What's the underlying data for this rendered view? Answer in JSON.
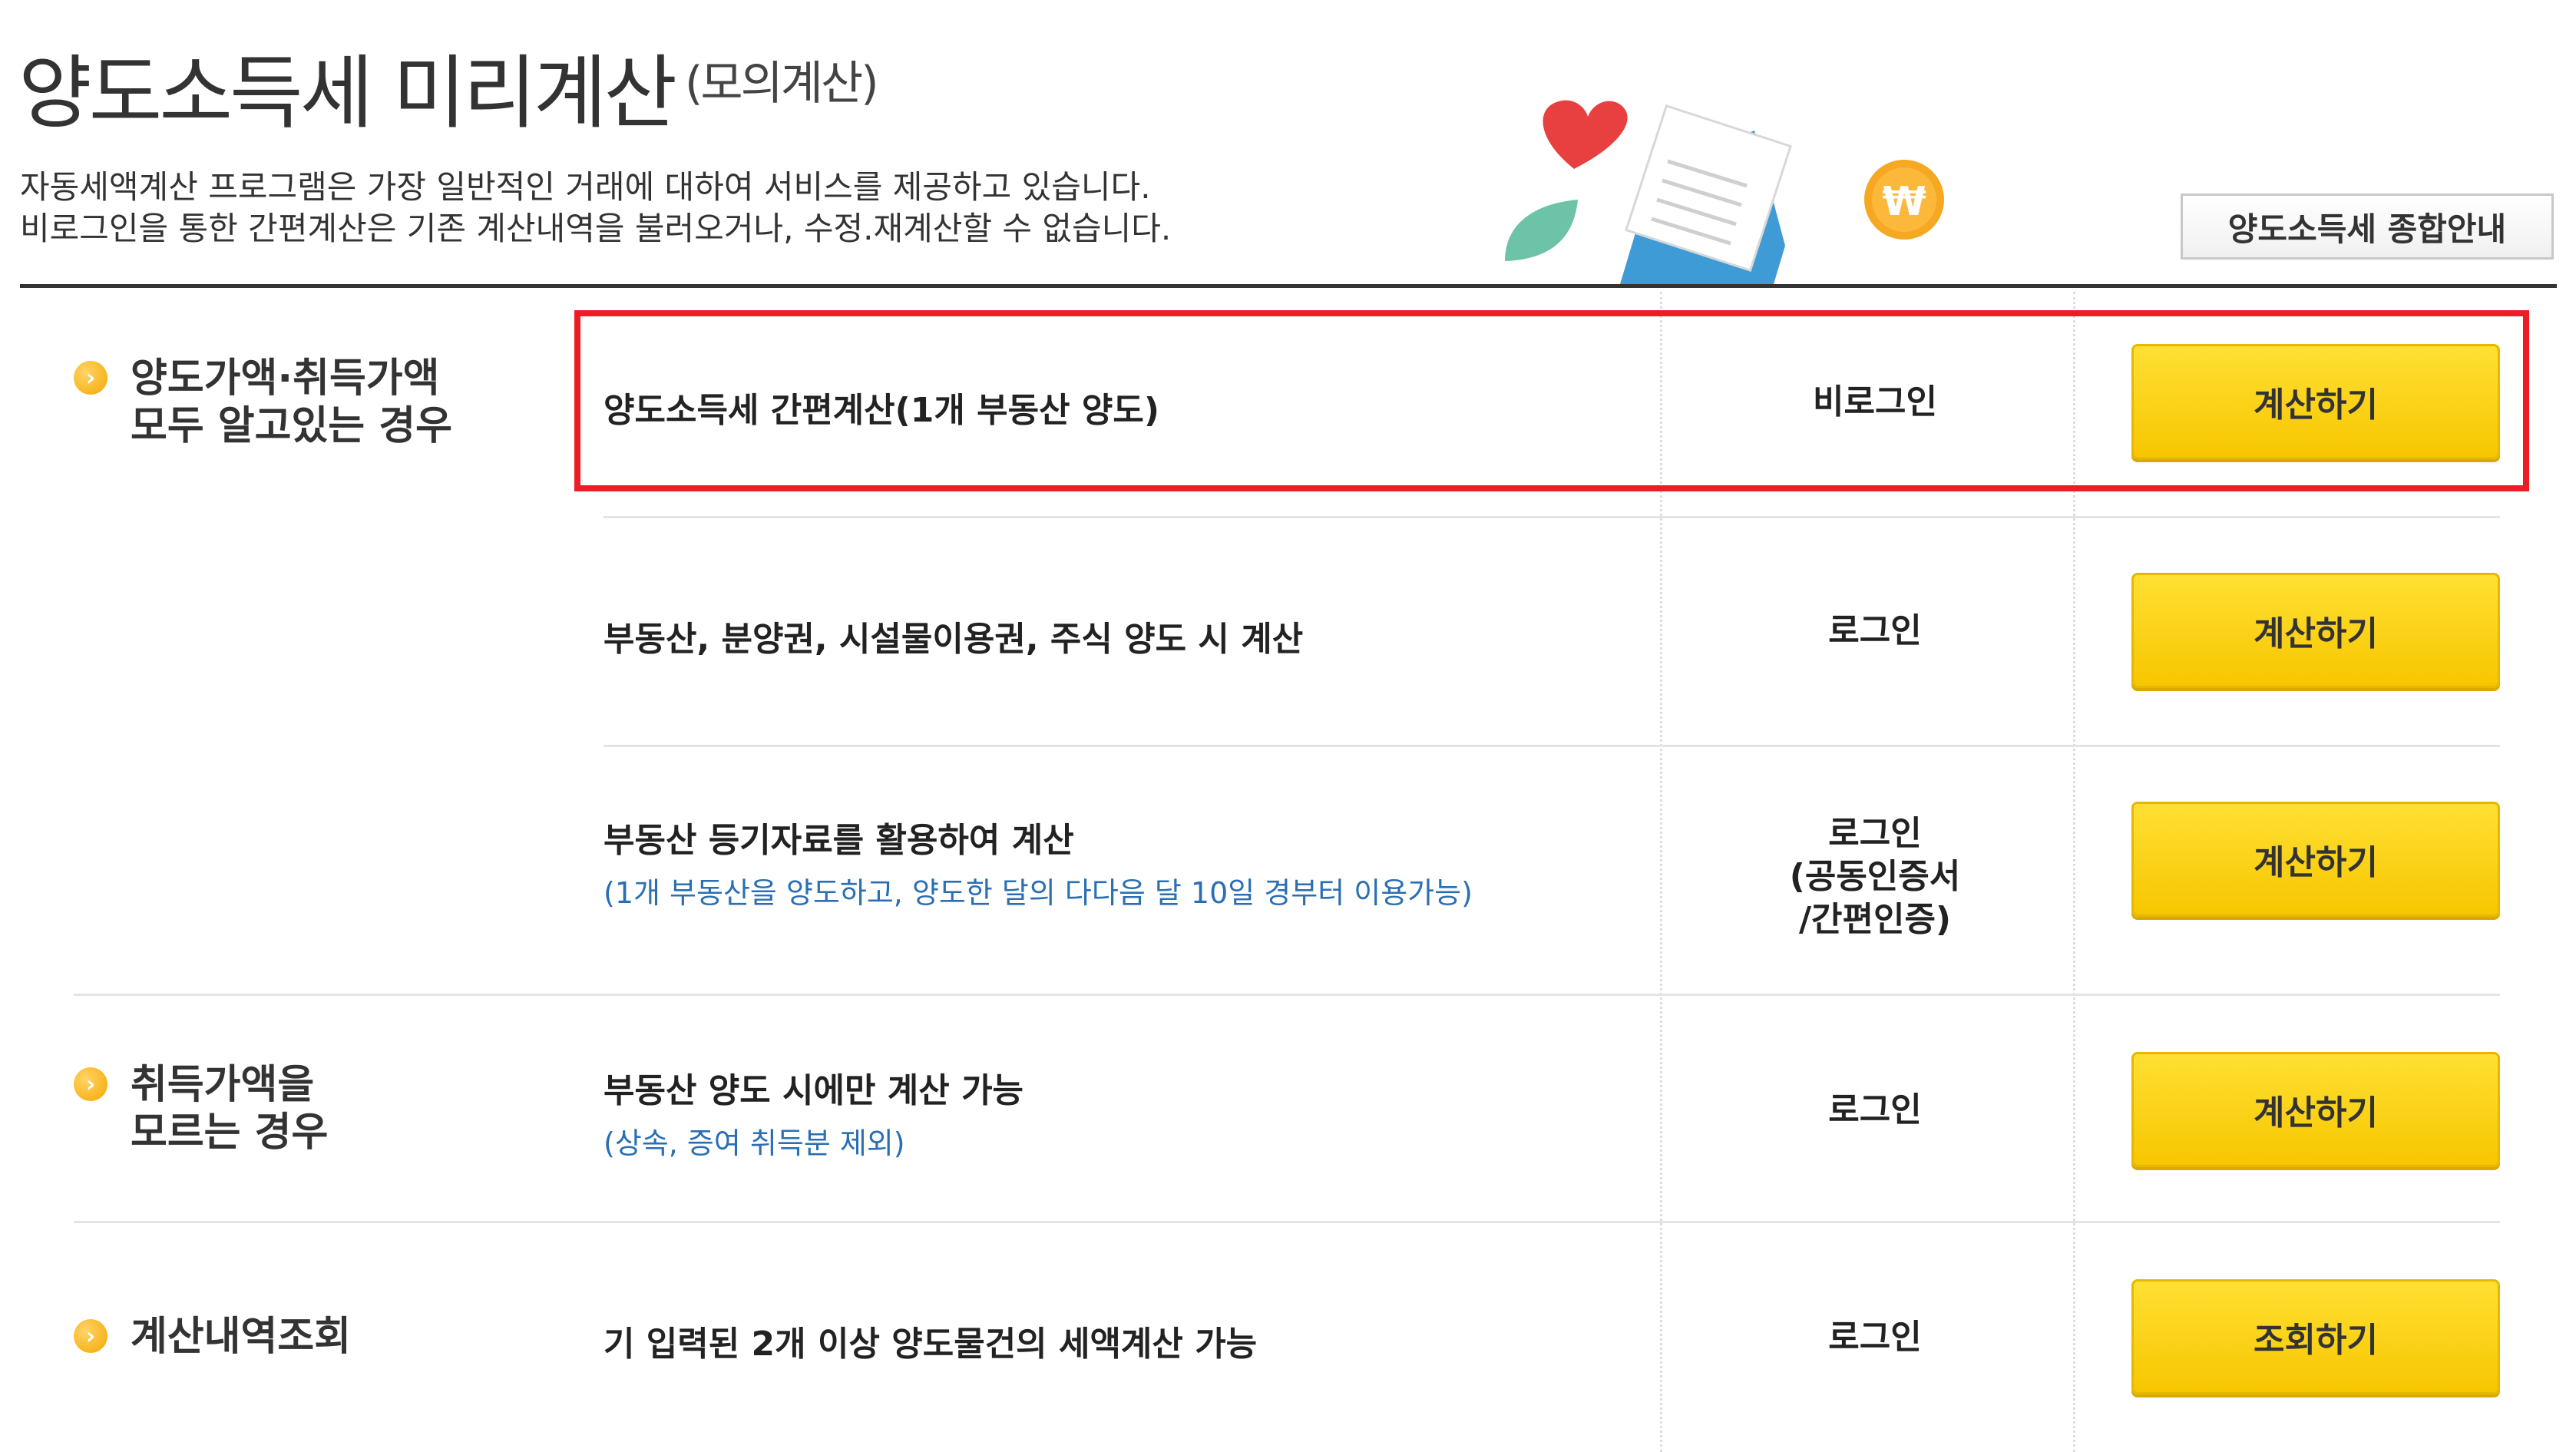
{
  "header": {
    "title": "양도소득세 미리계산",
    "subtitle": "(모의계산)",
    "description_line1": "자동세액계산 프로그램은 가장 일반적인 거래에 대하여 서비스를 제공하고 있습니다.",
    "description_line2": "비로그인을 통한 간편계산은 기존 계산내역을 불러오거나, 수정.재계산할 수 없습니다.",
    "guide_button": "양도소득세 종합안내"
  },
  "categories": [
    {
      "label": "양도가액·취득가액\n모두 알고있는 경우"
    },
    {
      "label": "취득가액을\n모르는 경우"
    },
    {
      "label": "계산내역조회"
    }
  ],
  "rows": [
    {
      "title": "양도소득세 간편계산(1개 부동산 양도)",
      "sub": "",
      "status": "비로그인",
      "button": "계산하기"
    },
    {
      "title": "부동산, 분양권, 시설물이용권, 주식 양도 시 계산",
      "sub": "",
      "status": "로그인",
      "button": "계산하기"
    },
    {
      "title": "부동산 등기자료를 활용하여 계산",
      "sub": "(1개 부동산을 양도하고, 양도한 달의 다다음 달 10일 경부터 이용가능)",
      "status": "로그인\n(공동인증서\n/간편인증)",
      "button": "계산하기"
    },
    {
      "title": "부동산 양도 시에만 계산 가능",
      "sub": "(상속, 증여 취득분 제외)",
      "status": "로그인",
      "button": "계산하기"
    },
    {
      "title": "기 입력된 2개 이상 양도물건의 세액계산 가능",
      "sub": "",
      "status": "로그인",
      "button": "조회하기"
    }
  ],
  "colors": {
    "highlight": "#ee1c25",
    "button": "#f7c600",
    "sub_text": "#2a6fb3"
  },
  "icons": [
    "heart-icon",
    "leaf-icon",
    "envelope-icon",
    "won-coin-icon",
    "bullet-arrow-icon"
  ]
}
